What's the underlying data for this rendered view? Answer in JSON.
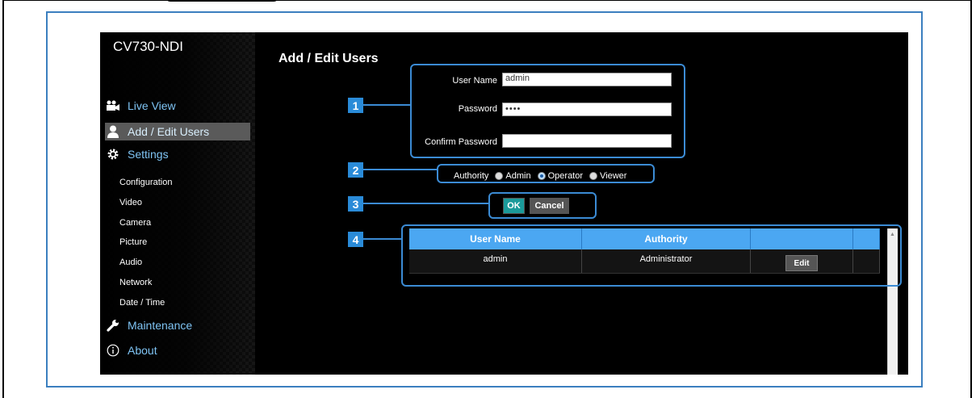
{
  "app": {
    "brand": "CV730-NDI"
  },
  "sidebar": {
    "main_items": [
      {
        "label": "Live View",
        "icon": "camera-icon",
        "active": false
      },
      {
        "label": "Add / Edit Users",
        "icon": "user-icon",
        "active": true
      },
      {
        "label": "Settings",
        "icon": "gear-icon",
        "active": false
      },
      {
        "label": "Maintenance",
        "icon": "wrench-icon",
        "active": false
      },
      {
        "label": "About",
        "icon": "info-icon",
        "active": false
      }
    ],
    "settings_items": [
      "Configuration",
      "Video",
      "Camera",
      "Picture",
      "Audio",
      "Network",
      "Date / Time"
    ]
  },
  "form": {
    "title": "Add / Edit Users",
    "user_name_label": "User Name",
    "user_name_value": "admin",
    "password_label": "Password",
    "password_value": "••••",
    "confirm_password_label": "Confirm Password",
    "confirm_password_value": "",
    "authority_label": "Authority",
    "authority_options": [
      {
        "label": "Admin",
        "checked": false
      },
      {
        "label": "Operator",
        "checked": true
      },
      {
        "label": "Viewer",
        "checked": false
      }
    ],
    "ok_label": "OK",
    "cancel_label": "Cancel"
  },
  "users_table": {
    "columns": [
      "User Name",
      "Authority",
      "",
      ""
    ],
    "rows": [
      {
        "user_name": "admin",
        "authority": "Administrator",
        "action": "Edit"
      }
    ]
  },
  "callouts": [
    "1",
    "2",
    "3",
    "4"
  ],
  "colors": {
    "accent_blue": "#4ba7f2",
    "callout_blue": "#3b8bd4",
    "nav_text": "#7fc4f4",
    "ok_button": "#1a9a9a"
  }
}
